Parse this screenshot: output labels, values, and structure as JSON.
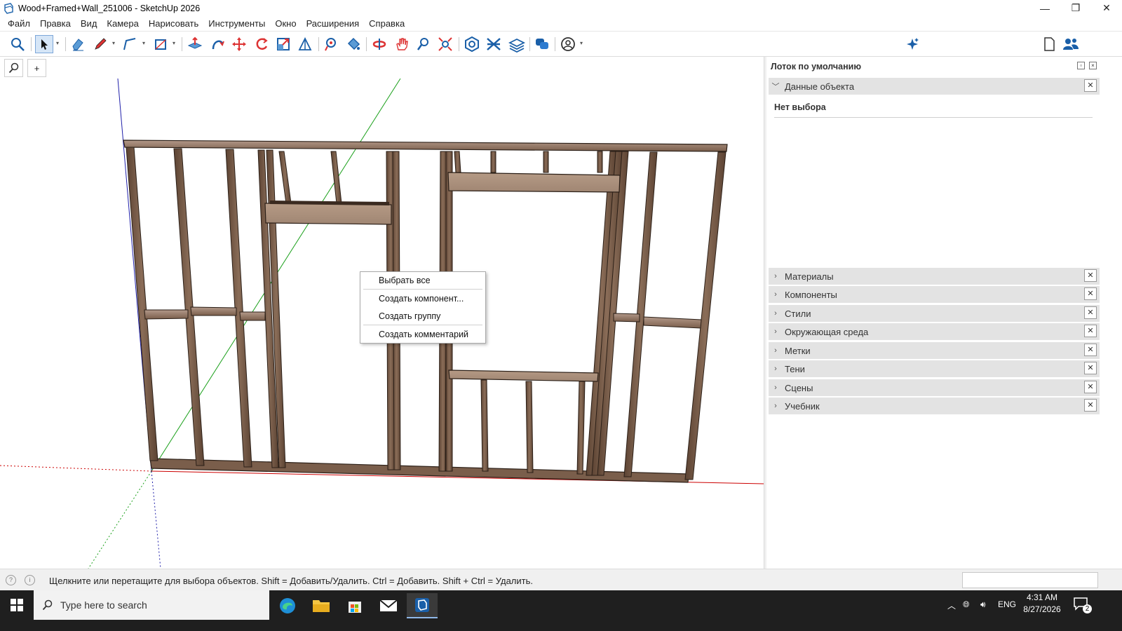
{
  "window": {
    "title": "Wood+Framed+Wall_251006 - SketchUp 2026",
    "minimize_glyph": "—",
    "maximize_glyph": "❐",
    "close_glyph": "✕"
  },
  "menu": [
    "Файл",
    "Правка",
    "Вид",
    "Камера",
    "Нарисовать",
    "Инструменты",
    "Окно",
    "Расширения",
    "Справка"
  ],
  "toolbar": {
    "tools": [
      "search-icon",
      "select-icon",
      "eraser-icon",
      "pencil-icon",
      "line-icon",
      "rectangle-icon",
      "push-pull-icon",
      "follow-me-icon",
      "move-icon",
      "rotate-icon",
      "scale-icon",
      "offset-icon",
      "tape-measure-icon",
      "paint-bucket-icon",
      "orbit-icon",
      "pan-icon",
      "zoom-icon",
      "zoom-extents-icon",
      "warehouse-icon",
      "extension-icon",
      "layout-icon",
      "comment-icon",
      "account-icon",
      "ai-sparkle-icon",
      "new-file-icon",
      "users-icon"
    ],
    "add_label": "+"
  },
  "context_menu": {
    "items": [
      "Выбрать все",
      "Создать компонент...",
      "Создать группу",
      "Создать комментарий"
    ]
  },
  "tray": {
    "title": "Лоток по умолчанию",
    "entity_info": {
      "label": "Данные объекта",
      "value": "Нет выбора"
    },
    "panels": [
      "Материалы",
      "Компоненты",
      "Стили",
      "Окружающая среда",
      "Метки",
      "Тени",
      "Сцены",
      "Учебник"
    ],
    "close_glyph": "✕"
  },
  "status": {
    "text": "Щелкните или перетащите для выбора объектов. Shift = Добавить/Удалить. Ctrl = Добавить. Shift + Ctrl = Удалить.",
    "measurements": ""
  },
  "taskbar": {
    "search_placeholder": "Type here to search",
    "lang": "ENG",
    "time": "4:31 AM",
    "date": "8/27/2026",
    "notification_count": "2"
  },
  "colors": {
    "wood": "#7a5e4b",
    "wood_light": "#a88b72",
    "axis_red": "#cc0000",
    "axis_green": "#1aa01a",
    "axis_blue": "#2020aa",
    "selection": "#d6e6f7"
  }
}
